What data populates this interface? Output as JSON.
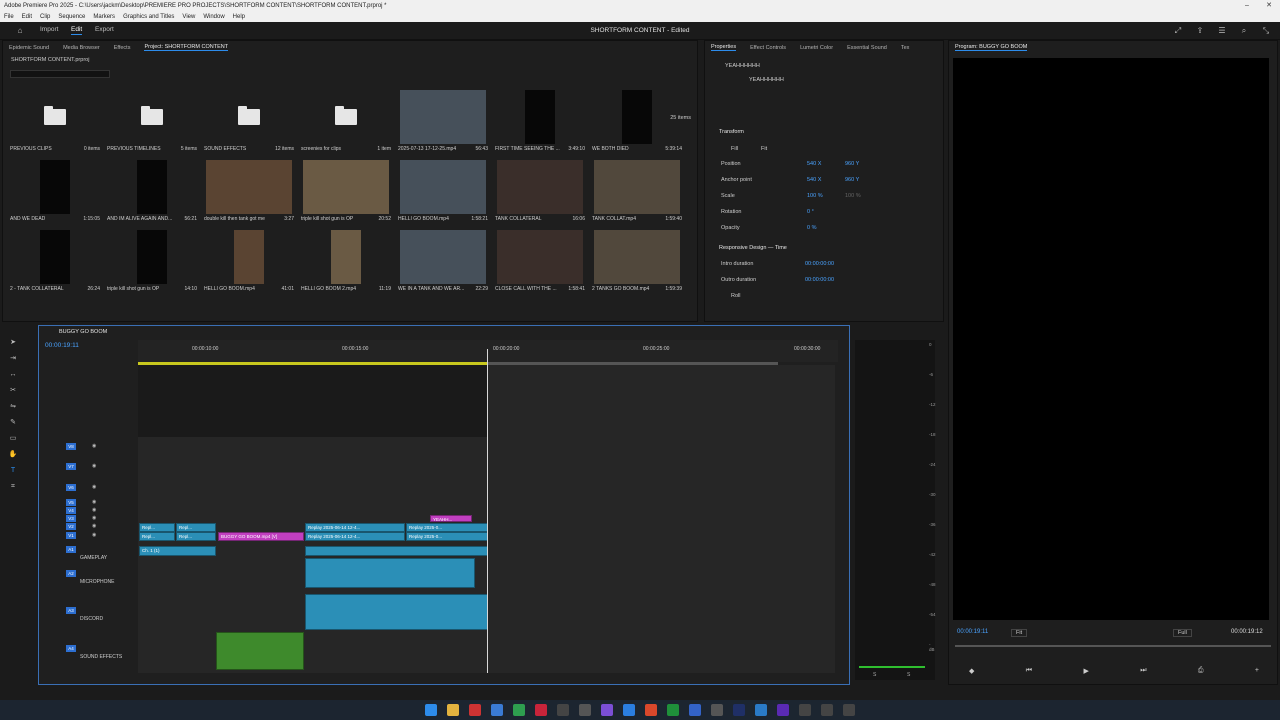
{
  "window": {
    "title": "Adobe Premiere Pro 2025 - C:\\Users\\jackm\\Desktop\\PREMIERE PRO PROJECTS\\SHORTFORM CONTENT\\SHORTFORM CONTENT.prproj *"
  },
  "menu": [
    "File",
    "Edit",
    "Clip",
    "Sequence",
    "Markers",
    "Graphics and Titles",
    "View",
    "Window",
    "Help"
  ],
  "workspace": {
    "tabs": [
      "Import",
      "Edit",
      "Export"
    ],
    "active": "Edit",
    "doc_title": "SHORTFORM CONTENT - Edited"
  },
  "left_tabs": [
    "Epidemic Sound",
    "Media Browser",
    "Effects",
    "Project: SHORTFORM CONTENT"
  ],
  "project": {
    "path": "SHORTFORM CONTENT.prproj",
    "count": "25 items",
    "items": [
      {
        "name": "PREVIOUS CLIPS",
        "meta": "0 items",
        "kind": "folder"
      },
      {
        "name": "PREVIOUS TIMELINES",
        "meta": "5 items",
        "kind": "folder"
      },
      {
        "name": "SOUND EFFECTS",
        "meta": "12 items",
        "kind": "folder"
      },
      {
        "name": "screenies for clips",
        "meta": "1 item",
        "kind": "folder"
      },
      {
        "name": "2025-07-13 17-12-25.mp4",
        "meta": "56:43",
        "kind": "video"
      },
      {
        "name": "FIRST TIME SEEING THE ...",
        "meta": "3:49:10",
        "kind": "video"
      },
      {
        "name": "WE BOTH DIED",
        "meta": "5:39:14",
        "kind": "video"
      },
      {
        "name": "AND WE DEAD",
        "meta": "1:15:05",
        "kind": "video"
      },
      {
        "name": "AND IM ALIVE AGAIN AND...",
        "meta": "56:21",
        "kind": "video"
      },
      {
        "name": "double kill then tank got me",
        "meta": "3:27",
        "kind": "video"
      },
      {
        "name": "triple kill shot gun is OP",
        "meta": "20:52",
        "kind": "video"
      },
      {
        "name": "HELLI GO BOOM.mp4",
        "meta": "1:58:21",
        "kind": "video"
      },
      {
        "name": "TANK COLLATERAL",
        "meta": "16:06",
        "kind": "video"
      },
      {
        "name": "TANK COLLAT.mp4",
        "meta": "1:59:40",
        "kind": "video"
      },
      {
        "name": "2 - TANK COLLATERAL",
        "meta": "26:24",
        "kind": "video"
      },
      {
        "name": "triple kill shot gun is OP",
        "meta": "14:10",
        "kind": "video"
      },
      {
        "name": "HELLI GO BOOM.mp4",
        "meta": "41:01",
        "kind": "video"
      },
      {
        "name": "HELLI GO BOOM 2.mp4",
        "meta": "11:19",
        "kind": "video"
      },
      {
        "name": "WE IN A TANK AND WE AR...",
        "meta": "22:29",
        "kind": "video"
      },
      {
        "name": "CLOSE CALL WITH THE ...",
        "meta": "1:58:41",
        "kind": "video"
      },
      {
        "name": "2 TANKS GO BOOM.mp4",
        "meta": "1:59:39",
        "kind": "video"
      }
    ]
  },
  "properties": {
    "tabs": [
      "Properties",
      "Effect Controls",
      "Lumetri Color",
      "Essential Sound",
      "Tex"
    ],
    "layer": "YEAHHHHHH",
    "sublayer": "YEAHHHHHH",
    "transform_title": "Transform",
    "fill": "Fill",
    "fit": "Fit",
    "rows": [
      {
        "label": "Position",
        "v1": "540 X",
        "v2": "960 Y"
      },
      {
        "label": "Anchor point",
        "v1": "540 X",
        "v2": "960 Y"
      },
      {
        "label": "Scale",
        "v1": "100 %",
        "v2": "100 %"
      },
      {
        "label": "Rotation",
        "v1": "0 °",
        "v2": ""
      },
      {
        "label": "Opacity",
        "v1": "0 %",
        "v2": ""
      }
    ],
    "responsive_title": "Responsive Design — Time",
    "intro_label": "Intro duration",
    "intro_val": "00:00:00:00",
    "outro_label": "Outro duration",
    "outro_val": "00:00:00:00",
    "roll": "Roll"
  },
  "program": {
    "title": "Program: BUGGY GO BOOM",
    "timecode": "00:00:19:11",
    "fit": "Fit",
    "quality": "Full",
    "duration": "00:00:19:12"
  },
  "timeline": {
    "sequence": "BUGGY GO BOOM",
    "timecode": "00:00:19:11",
    "ruler": [
      "00:00:10:00",
      "00:00:15:00",
      "00:00:20:00",
      "00:00:25:00",
      "00:00:30:00"
    ],
    "video_tracks": [
      "V8",
      "V7",
      "V6",
      "V5",
      "V4",
      "V3",
      "V2",
      "V1"
    ],
    "audio_tracks": [
      {
        "id": "A1",
        "name": "GAMEPLAY"
      },
      {
        "id": "A2",
        "name": "MICROPHONE"
      },
      {
        "id": "A3",
        "name": "DISCORD"
      },
      {
        "id": "A4",
        "name": "SOUND EFFECTS"
      }
    ],
    "clips": {
      "v2a": "Repl...",
      "v2b": "Repl...",
      "v2c": "Replay 2025-06-14 12-4...",
      "v2d": "Replay 2025-0...",
      "v1a": "Repl...",
      "v1b": "Repl...",
      "v1c": "BUGGY GO BOOM.mp4 [V]",
      "v1d": "Replay 2025-06-14 12-4...",
      "v1e": "Replay 2025-0...",
      "title": "YEAHH...",
      "a1": "Ch. 1 (1)"
    }
  },
  "audio_meter": {
    "labels": [
      "0",
      "-6",
      "-12",
      "-18",
      "-24",
      "-30",
      "-36",
      "-42",
      "-48",
      "-54",
      "-dB"
    ],
    "solo": "S"
  }
}
